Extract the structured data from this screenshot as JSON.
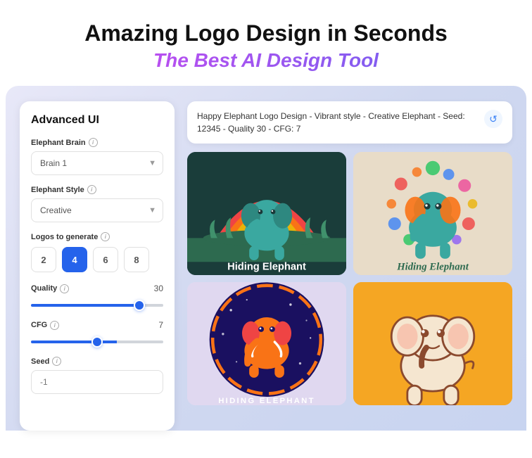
{
  "header": {
    "title": "Amazing Logo Design in Seconds",
    "subtitle": "The Best AI Design Tool"
  },
  "panel": {
    "title": "Advanced UI",
    "brain_label": "Elephant Brain",
    "brain_info": "i",
    "brain_placeholder": "Brain 1",
    "style_label": "Elephant Style",
    "style_info": "i",
    "style_placeholder": "Creative",
    "logos_label": "Logos to generate",
    "logos_info": "i",
    "number_options": [
      "2",
      "4",
      "6",
      "8"
    ],
    "active_number": "4",
    "quality_label": "Quality",
    "quality_info": "i",
    "quality_value": "30",
    "quality_percent": 85,
    "cfg_label": "CFG",
    "cfg_info": "i",
    "cfg_value": "7",
    "cfg_percent": 65,
    "seed_label": "Seed",
    "seed_info": "i",
    "seed_placeholder": "-1"
  },
  "prompt": {
    "text": "Happy Elephant Logo Design - Vibrant style - Creative Elephant - Seed: 12345 - Quality 30 -  CFG: 7",
    "refresh_icon": "↺"
  },
  "logos": [
    {
      "id": 1,
      "name": "logo-dark-rainbow"
    },
    {
      "id": 2,
      "name": "logo-beige-colorful"
    },
    {
      "id": 3,
      "name": "logo-purple-circle"
    },
    {
      "id": 4,
      "name": "logo-yellow-cute"
    }
  ]
}
